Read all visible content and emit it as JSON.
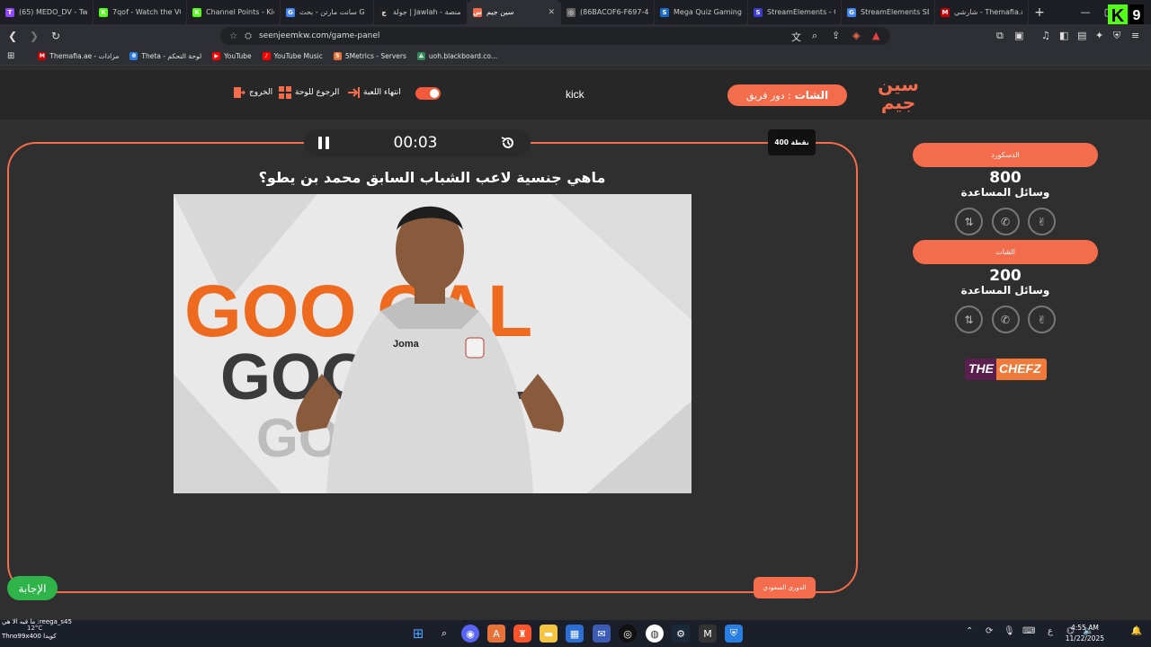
{
  "browser": {
    "tabs": [
      {
        "title": "(65) MEDO_DV - Twi",
        "color": "#9146ff",
        "glyph": "T"
      },
      {
        "title": "7qof - Watch the VO",
        "color": "#53fc18",
        "glyph": "K"
      },
      {
        "title": "Channel Points - Kic",
        "color": "#53fc18",
        "glyph": "K"
      },
      {
        "title": "سانت مارتن - بحث G",
        "color": "#4285f4",
        "glyph": "G"
      },
      {
        "title": "جولة | Jawlah - منصة",
        "color": "#222",
        "glyph": "ج"
      },
      {
        "title": "سين جيم",
        "color": "#f36c4c",
        "glyph": "س"
      },
      {
        "title": "(86BACOF6-F697-42",
        "color": "#666",
        "glyph": "◎"
      },
      {
        "title": "Mega Quiz Gaming",
        "color": "#1b6ac9",
        "glyph": "S"
      },
      {
        "title": "StreamElements - C",
        "color": "#3b3bd6",
        "glyph": "S"
      },
      {
        "title": "StreamElements SE",
        "color": "#4285f4",
        "glyph": "G"
      },
      {
        "title": "شارشي - Themafia.ae",
        "color": "#c00",
        "glyph": "M"
      }
    ],
    "active_tab_index": 5,
    "url": "seenjeemkw.com/game-panel",
    "bookmarks": [
      {
        "label": "Themafia.ae - مزادات",
        "color": "#c00",
        "glyph": "M"
      },
      {
        "label": "Theta - لوحة التحكم",
        "color": "#2a7de1",
        "glyph": "θ"
      },
      {
        "label": "YouTube",
        "color": "#ff0000",
        "glyph": "▶"
      },
      {
        "label": "YouTube Music",
        "color": "#ff0000",
        "glyph": "♪"
      },
      {
        "label": "5Metrics - Servers",
        "color": "#e8733a",
        "glyph": "5"
      },
      {
        "label": "uoh.blackboard.co...",
        "color": "#2e8b57",
        "glyph": "⟁"
      }
    ],
    "kick_badge": {
      "letter": "K",
      "count": "9"
    }
  },
  "header": {
    "exit_label": "الخروج",
    "back_label": "الرجوع للوحة",
    "end_label": "انتهاء اللعبة",
    "stream_label": "kick",
    "turn_prefix": "دور فريق :",
    "turn_team": "الشات",
    "brand": "سين جيم"
  },
  "question": {
    "timer": "00:03",
    "points": "400 نقطة",
    "text": "ماهي جنسية لاعب الشباب السابق محمد بن يطو؟",
    "category": "الدوري السعودي",
    "answer_label": "الإجابة",
    "image_text_top": "GOO  OAL",
    "image_text_mid": "GOO  OAL",
    "image_text_bot": "GOO  OAL",
    "image_jersey_brand": "Joma"
  },
  "teams": [
    {
      "name": "الدسكورد",
      "score": "800",
      "aids_label": "وسائل المساعدة"
    },
    {
      "name": "الشات",
      "score": "200",
      "aids_label": "وسائل المساعدة"
    }
  ],
  "sponsor": {
    "part1": "THE",
    "part2": "CHEFZ"
  },
  "taskbar": {
    "chat_line1": "ما فيه الا هي :reega_s45",
    "chat_line2": "Thno99x400 كويدا",
    "temperature": "12°C",
    "time": "4:55 AM",
    "date": "11/22/2025",
    "lang": "ع"
  },
  "colors": {
    "accent": "#f36c4c",
    "answer": "#2fb44a",
    "background": "#2f2f2f"
  }
}
